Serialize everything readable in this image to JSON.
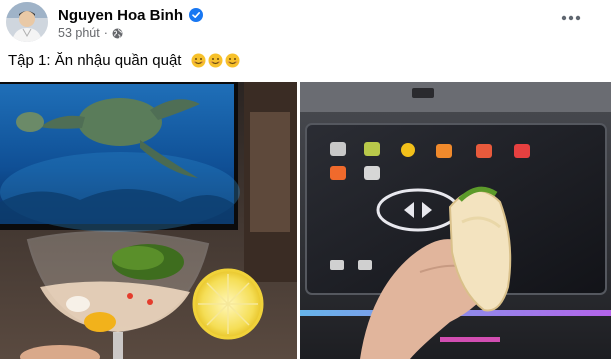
{
  "post": {
    "author": {
      "name": "Nguyen Hoa Binh",
      "verified_icon": "verified-badge-icon",
      "avatar_icon": "profile-avatar"
    },
    "timestamp": "53 phút",
    "separator": "·",
    "privacy_icon": "globe-icon",
    "more_icon": "more-options-icon",
    "caption": {
      "text": "Tập 1: Ăn nhậu quần quật",
      "emojis": [
        "smiling-face-emoji",
        "smiling-face-emoji",
        "smiling-face-emoji"
      ]
    },
    "photos": [
      {
        "name": "photo-cocktail-glass-tv"
      },
      {
        "name": "photo-car-dashboard-sandwich"
      }
    ]
  },
  "colors": {
    "text_primary": "#050505",
    "text_secondary": "#65676b",
    "verified_blue": "#1877f2"
  }
}
